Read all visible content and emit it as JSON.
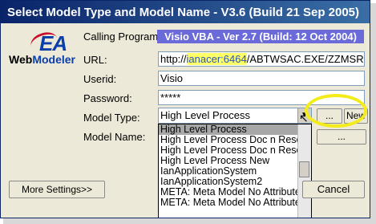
{
  "window": {
    "title": "Select Model Type and Model Name - V3.6 (Build 21 Sep 2005)"
  },
  "logo": {
    "ea": "EA",
    "web": "Web",
    "modeler": "Modeler"
  },
  "form": {
    "calling_program_label": "Calling Program:",
    "calling_program_value": "Visio VBA - Ver 2.7 (Build: 12 Oct 2004)",
    "url_label": "URL:",
    "url_prefix": "http://",
    "url_host": "ianacer:6464",
    "url_suffix": "/ABTWSAC.EXE/ZZMSRequester",
    "userid_label": "Userid:",
    "userid_value": "Visio",
    "password_label": "Password:",
    "password_value": "*****",
    "model_type_label": "Model Type:",
    "model_type_value": "High Level Process",
    "model_name_label": "Model Name:"
  },
  "buttons": {
    "browse": "...",
    "new": "New",
    "browse2": "...",
    "more_settings": "More Settings>>",
    "cancel": "Cancel"
  },
  "dropdown_items": [
    "High Level Process",
    "High Level Process Doc n Resource",
    "High Level Process Doc n Resource",
    "High Level Process New",
    "IanApplicationSystem",
    "IanApplicationSystem2",
    "META: Meta Model No Attributes",
    "META: Meta Model No Attributes"
  ]
}
